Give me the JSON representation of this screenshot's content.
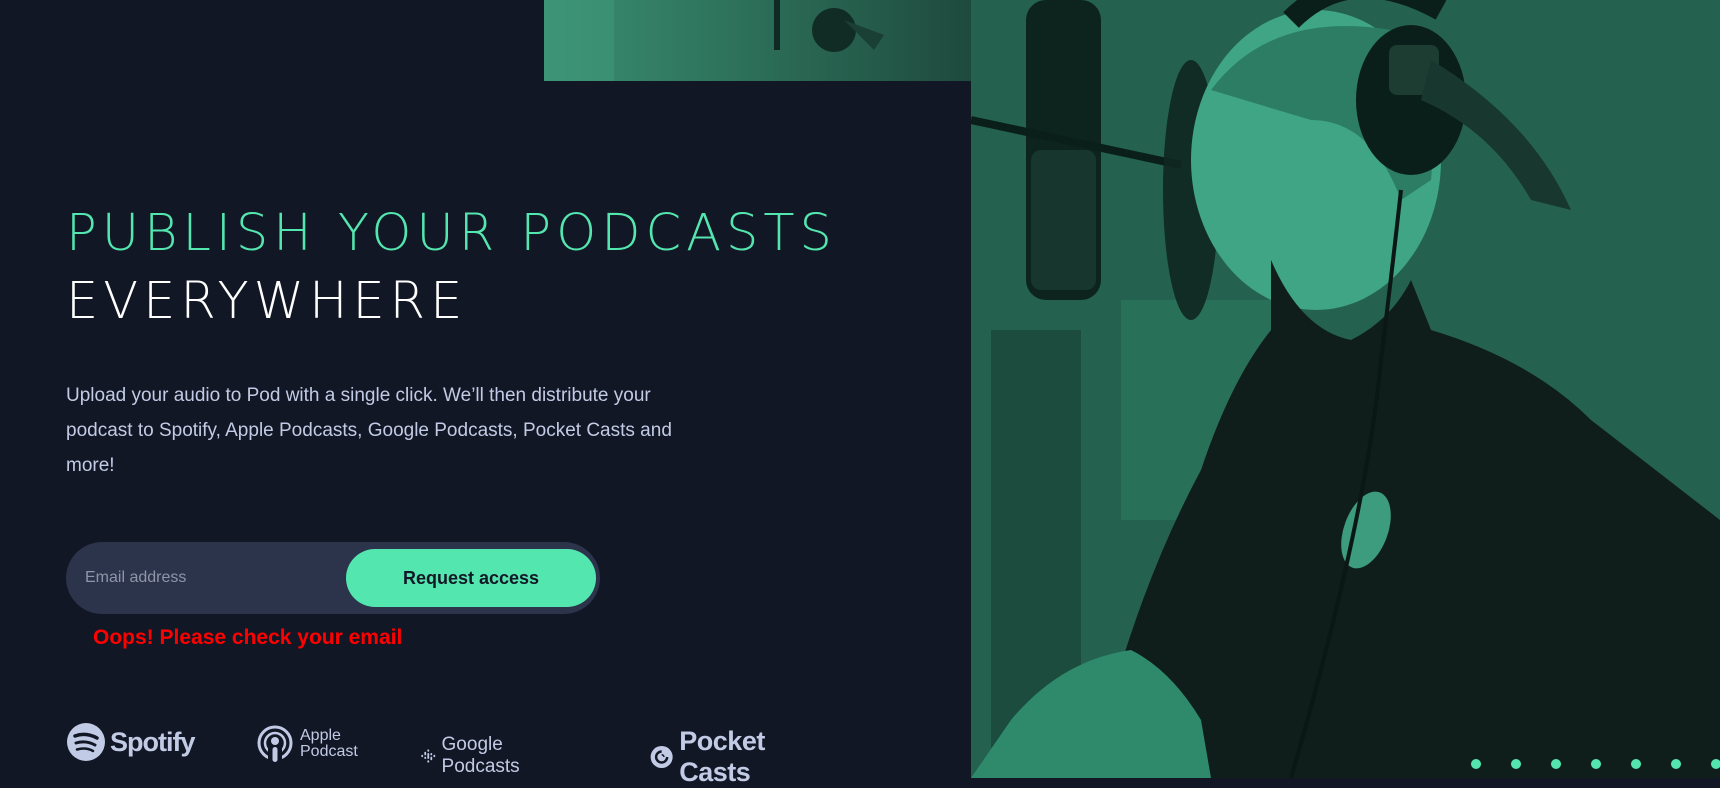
{
  "hero": {
    "headline_line1": "PUBLISH YOUR PODCASTS",
    "headline_line2": "EVERYWHERE",
    "description": "Upload your audio to Pod with a single click. We’ll then distribute your podcast to Spotify, Apple Podcasts, Google Podcasts, Pocket Casts and more!"
  },
  "form": {
    "email_placeholder": "Email address",
    "email_value": "",
    "submit_label": "Request access",
    "error_message": "Oops! Please check your email"
  },
  "platforms": {
    "spotify": {
      "label": "Spotify",
      "icon": "spotify-icon"
    },
    "apple": {
      "label_line1": "Apple",
      "label_line2": "Podcast",
      "icon": "apple-podcasts-icon"
    },
    "google": {
      "label": "Google Podcasts",
      "icon": "google-podcasts-icon"
    },
    "pocket": {
      "label": "Pocket Casts",
      "icon": "pocket-casts-icon"
    }
  },
  "colors": {
    "background": "#121725",
    "accent": "#54e6af",
    "text_muted": "#c2cbe5",
    "input_bg": "#2c344b",
    "error": "#ff0000"
  },
  "images": {
    "hero_photo": "podcaster-with-microphone-photo"
  },
  "decoration": {
    "dot_pattern": "dot-pattern"
  }
}
